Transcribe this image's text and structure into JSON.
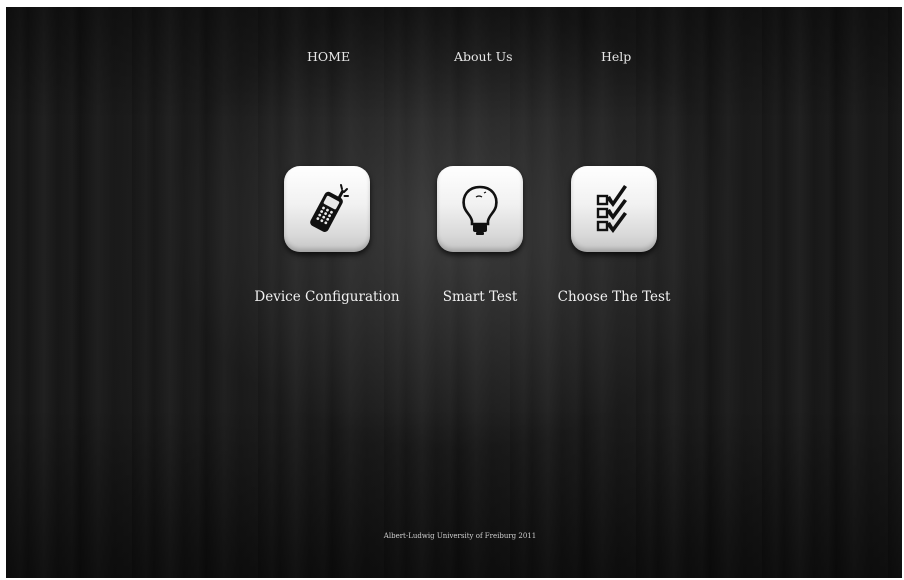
{
  "nav": {
    "home": "HOME",
    "about": "About Us",
    "help": "Help"
  },
  "tiles": [
    {
      "label": "Device Configuration",
      "icon": "mobile-phone-icon"
    },
    {
      "label": "Smart Test",
      "icon": "lightbulb-icon"
    },
    {
      "label": "Choose The Test",
      "icon": "checklist-icon"
    }
  ],
  "footer": {
    "text": "Albert-Ludwig University of Freiburg 2011"
  }
}
